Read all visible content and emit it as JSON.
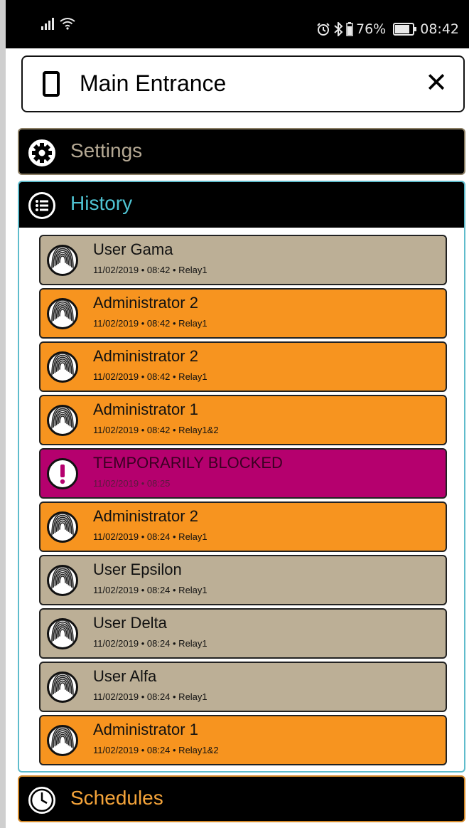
{
  "status_bar": {
    "alarm_icon": "alarm-icon",
    "bluetooth_icon": "bluetooth-icon",
    "battery_percent": "76%",
    "time": "08:42"
  },
  "header": {
    "title": "Main Entrance",
    "close_label": "✕"
  },
  "sections": {
    "settings": {
      "label": "Settings",
      "color": "#b5a994"
    },
    "history": {
      "label": "History",
      "color": "#4fc3d2"
    },
    "schedules": {
      "label": "Schedules",
      "color": "#f5a43a"
    }
  },
  "history": {
    "entries": [
      {
        "name": "User Gama",
        "meta": "11/02/2019 • 08:42 • Relay1",
        "kind": "user"
      },
      {
        "name": "Administrator 2",
        "meta": "11/02/2019 • 08:42 • Relay1",
        "kind": "admin"
      },
      {
        "name": "Administrator 2",
        "meta": "11/02/2019 • 08:42 • Relay1",
        "kind": "admin"
      },
      {
        "name": "Administrator 1",
        "meta": "11/02/2019 • 08:42 • Relay1&2",
        "kind": "admin"
      },
      {
        "name": "TEMPORARILY BLOCKED",
        "meta": "11/02/2019 • 08:25",
        "kind": "blocked"
      },
      {
        "name": "Administrator 2",
        "meta": "11/02/2019 • 08:24 • Relay1",
        "kind": "admin"
      },
      {
        "name": "User Epsilon",
        "meta": "11/02/2019 • 08:24 • Relay1",
        "kind": "user"
      },
      {
        "name": "User Delta",
        "meta": "11/02/2019 • 08:24 • Relay1",
        "kind": "user"
      },
      {
        "name": "User Alfa",
        "meta": "11/02/2019 • 08:24 • Relay1",
        "kind": "user"
      },
      {
        "name": "Administrator 1",
        "meta": "11/02/2019 • 08:24 • Relay1&2",
        "kind": "admin"
      }
    ]
  },
  "colors": {
    "user": "#bcaf96",
    "admin": "#f7941f",
    "blocked": "#b5006e"
  }
}
